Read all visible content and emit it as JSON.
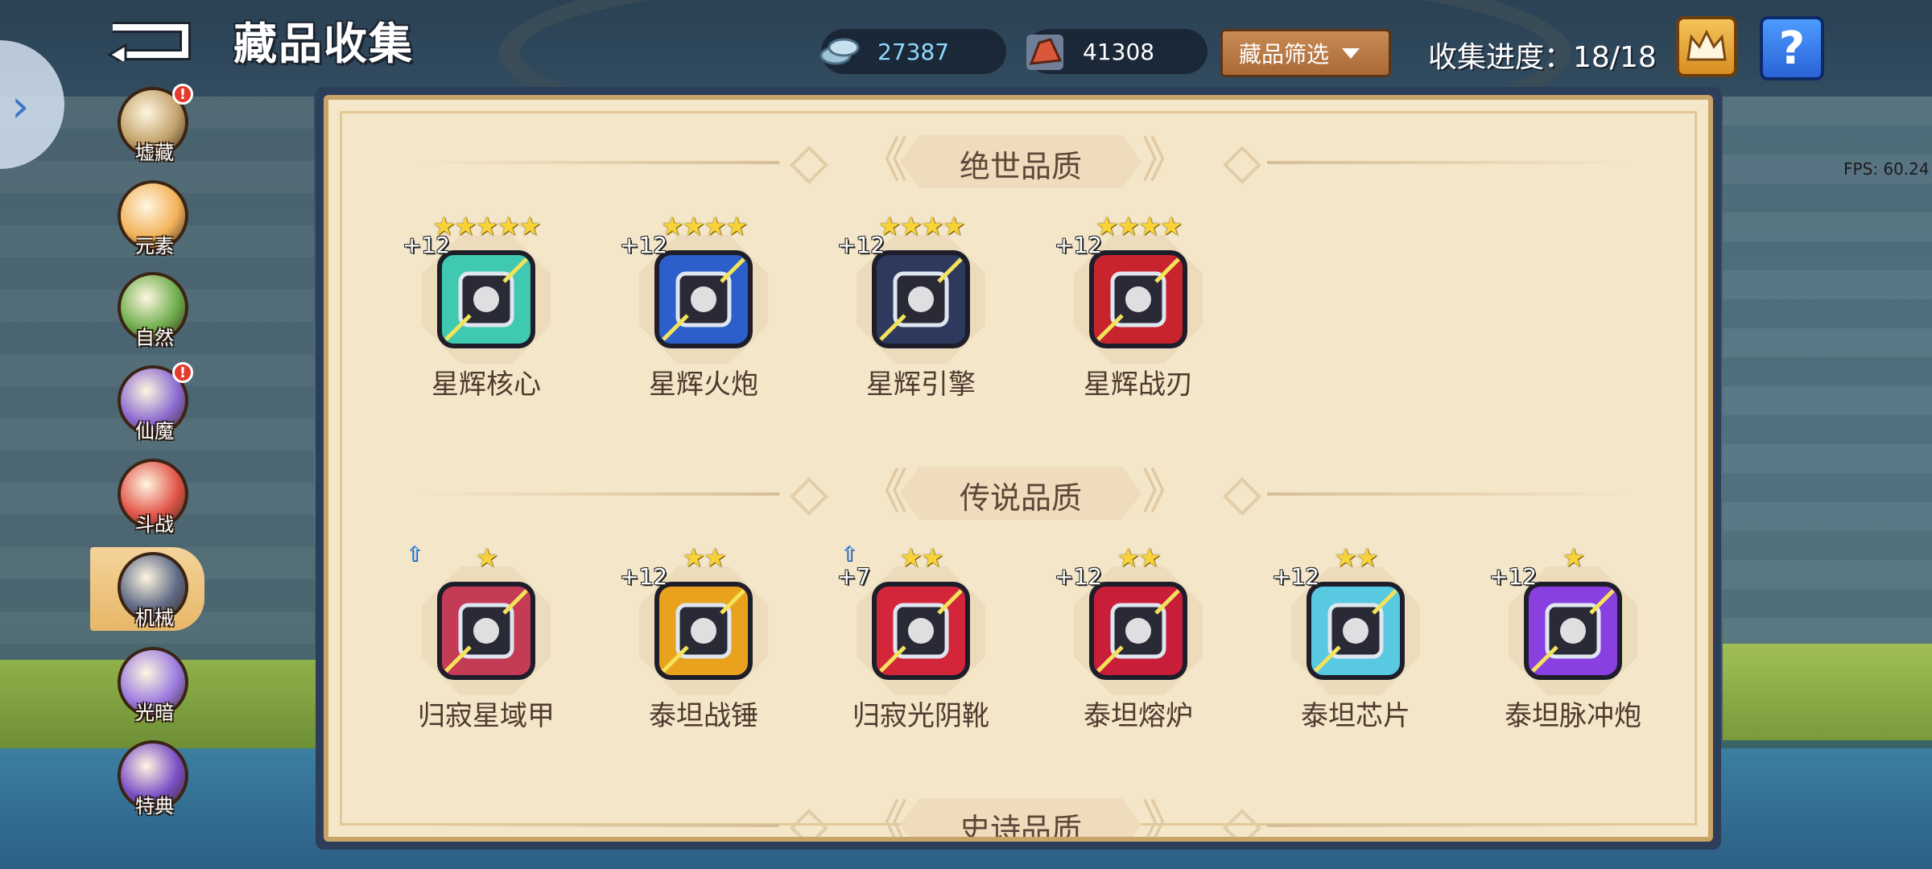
{
  "header": {
    "title": "藏品收集",
    "currency_1": "27387",
    "currency_2": "41308",
    "filter_label": "藏品筛选",
    "progress_label": "收集进度：18/18",
    "help_label": "?",
    "fps": "FPS: 60.24"
  },
  "categories": [
    {
      "label": "墟藏",
      "alert": "!",
      "color": "#c2a26b"
    },
    {
      "label": "元素",
      "alert": "",
      "color": "#f3b25b"
    },
    {
      "label": "自然",
      "alert": "",
      "color": "#6fae4d"
    },
    {
      "label": "仙魔",
      "alert": "!",
      "color": "#8b6bd1"
    },
    {
      "label": "斗战",
      "alert": "",
      "color": "#e2554a"
    },
    {
      "label": "机械",
      "alert": "",
      "color": "#5f6a86",
      "selected": true
    },
    {
      "label": "光暗",
      "alert": "",
      "color": "#9b7be0"
    },
    {
      "label": "特典",
      "alert": "",
      "color": "#7a4fc6"
    }
  ],
  "sections": [
    {
      "title": "绝世品质",
      "items": [
        {
          "name": "星辉核心",
          "stars": "★★★★★",
          "level": "+12",
          "icon": "starlight-core-icon",
          "color": "#3fc9b0"
        },
        {
          "name": "星辉火炮",
          "stars": "★★★★",
          "level": "+12",
          "icon": "starlight-cannon-icon",
          "color": "#2c5fc9"
        },
        {
          "name": "星辉引擎",
          "stars": "★★★★",
          "level": "+12",
          "icon": "starlight-engine-icon",
          "color": "#2d3a5e"
        },
        {
          "name": "星辉战刃",
          "stars": "★★★★",
          "level": "+12",
          "icon": "starlight-blade-icon",
          "color": "#c8242e"
        }
      ]
    },
    {
      "title": "传说品质",
      "items": [
        {
          "name": "归寂星域甲",
          "stars": "★",
          "level": "",
          "upgrade": "⇧",
          "icon": "void-armor-icon",
          "color": "#c43b55"
        },
        {
          "name": "泰坦战锤",
          "stars": "★★",
          "level": "+12",
          "icon": "titan-hammer-icon",
          "color": "#e8a21d"
        },
        {
          "name": "归寂光阴靴",
          "stars": "★★",
          "level": "+7",
          "upgrade": "⇧",
          "icon": "void-boots-icon",
          "color": "#d3263b"
        },
        {
          "name": "泰坦熔炉",
          "stars": "★★",
          "level": "+12",
          "icon": "titan-furnace-icon",
          "color": "#c81e3a"
        },
        {
          "name": "泰坦芯片",
          "stars": "★★",
          "level": "+12",
          "icon": "titan-chip-icon",
          "color": "#58c9e0"
        },
        {
          "name": "泰坦脉冲炮",
          "stars": "★",
          "level": "+12",
          "icon": "titan-pulse-cannon-icon",
          "color": "#8a3fe0"
        }
      ]
    },
    {
      "title": "史诗品质",
      "items": []
    }
  ]
}
